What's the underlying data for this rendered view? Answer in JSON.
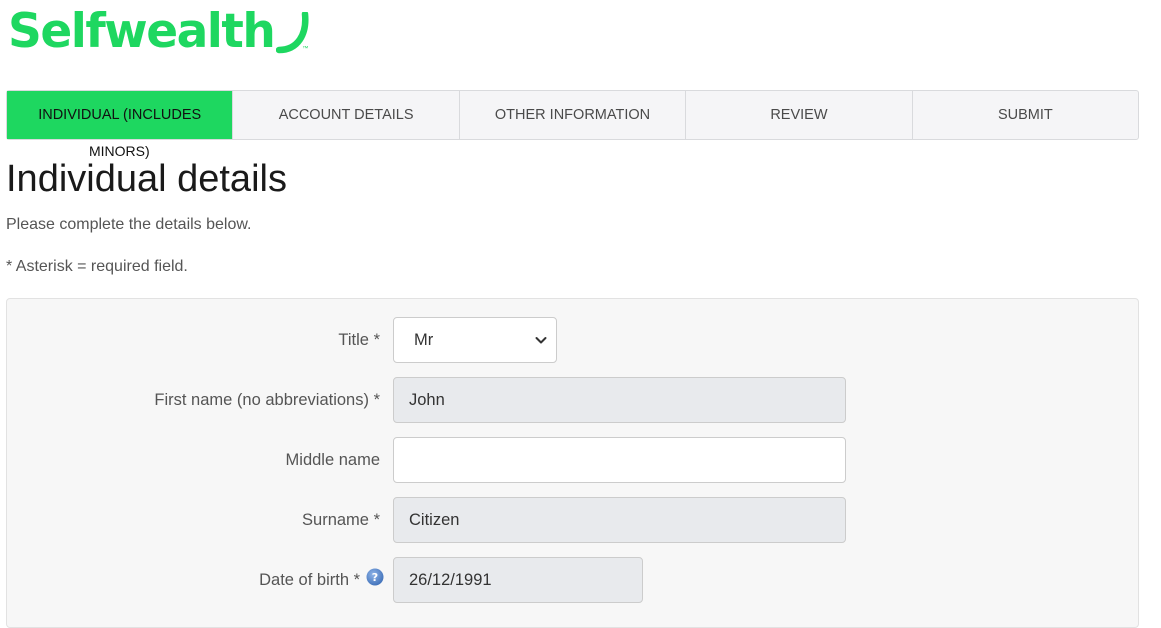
{
  "brand": {
    "name": "Selfwealth",
    "trademark": "™",
    "color": "#1ed760"
  },
  "steps": [
    {
      "label": "INDIVIDUAL (INCLUDES",
      "overflow": "MINORS)",
      "active": true
    },
    {
      "label": "ACCOUNT DETAILS",
      "active": false
    },
    {
      "label": "OTHER INFORMATION",
      "active": false
    },
    {
      "label": "REVIEW",
      "active": false
    },
    {
      "label": "SUBMIT",
      "active": false
    }
  ],
  "page": {
    "title": "Individual details",
    "lead": "Please complete the details below.",
    "note": "* Asterisk = required field."
  },
  "form": {
    "title": {
      "label": "Title *",
      "value": "Mr",
      "icon": "chevron-down-icon"
    },
    "first_name": {
      "label": "First name (no abbreviations) *",
      "value": "John"
    },
    "middle_name": {
      "label": "Middle name",
      "value": ""
    },
    "surname": {
      "label": "Surname *",
      "value": "Citizen"
    },
    "dob": {
      "label": "Date of birth *",
      "value": "26/12/1991",
      "icon": "help-icon"
    }
  }
}
